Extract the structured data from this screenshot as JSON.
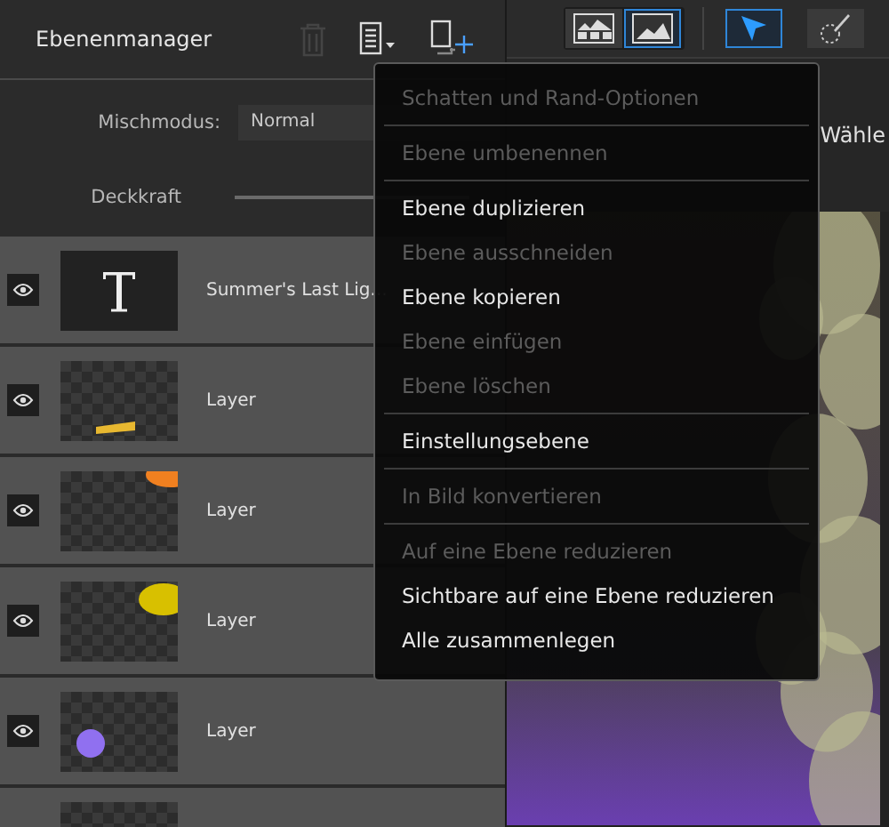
{
  "panel": {
    "title": "Ebenenmanager",
    "header_buttons": [
      {
        "kind": "trash",
        "disabled": true
      },
      {
        "kind": "menu",
        "disabled": false
      },
      {
        "kind": "new-layer",
        "disabled": false
      }
    ],
    "blend_mode": {
      "label": "Mischmodus:",
      "value": "Normal"
    },
    "opacity": {
      "label": "Deckkraft",
      "level": 1
    },
    "layers": [
      {
        "kind": "text",
        "name": "Summer's Last Lig...",
        "visible": true
      },
      {
        "kind": "raster",
        "name": "Layer",
        "visible": true,
        "color": "#e8b830"
      },
      {
        "kind": "raster",
        "name": "Layer",
        "visible": true,
        "color": "#f08020"
      },
      {
        "kind": "raster",
        "name": "Layer",
        "visible": true,
        "color": "#d8c000"
      },
      {
        "kind": "raster",
        "name": "Layer",
        "visible": true,
        "color": "#9070f0"
      },
      {
        "kind": "raster"
      }
    ]
  },
  "toolbar": {
    "view_buttons": [
      {
        "kind": "grid",
        "selected": false
      },
      {
        "kind": "single",
        "selected": true
      }
    ],
    "tools": [
      {
        "kind": "pointer",
        "selected": true
      },
      {
        "kind": "brush",
        "selected": false
      }
    ]
  },
  "options": {
    "label": "Wähle"
  },
  "context_menu": {
    "groups": [
      [
        {
          "label": "Schatten und Rand-Optionen",
          "disabled": true
        }
      ],
      [
        {
          "label": "Ebene umbenennen",
          "disabled": true
        }
      ],
      [
        {
          "label": "Ebene duplizieren",
          "disabled": false
        },
        {
          "label": "Ebene ausschneiden",
          "disabled": true
        },
        {
          "label": "Ebene kopieren",
          "disabled": false
        },
        {
          "label": "Ebene einfügen",
          "disabled": true
        },
        {
          "label": "Ebene löschen",
          "disabled": true
        }
      ],
      [
        {
          "label": "Einstellungsebene",
          "disabled": false
        }
      ],
      [
        {
          "label": "In Bild konvertieren",
          "disabled": true
        }
      ],
      [
        {
          "label": "Auf eine Ebene reduzieren",
          "disabled": true
        },
        {
          "label": "Sichtbare auf eine Ebene reduzieren",
          "disabled": false
        },
        {
          "label": "Alle zusammenlegen",
          "disabled": false
        }
      ]
    ]
  }
}
